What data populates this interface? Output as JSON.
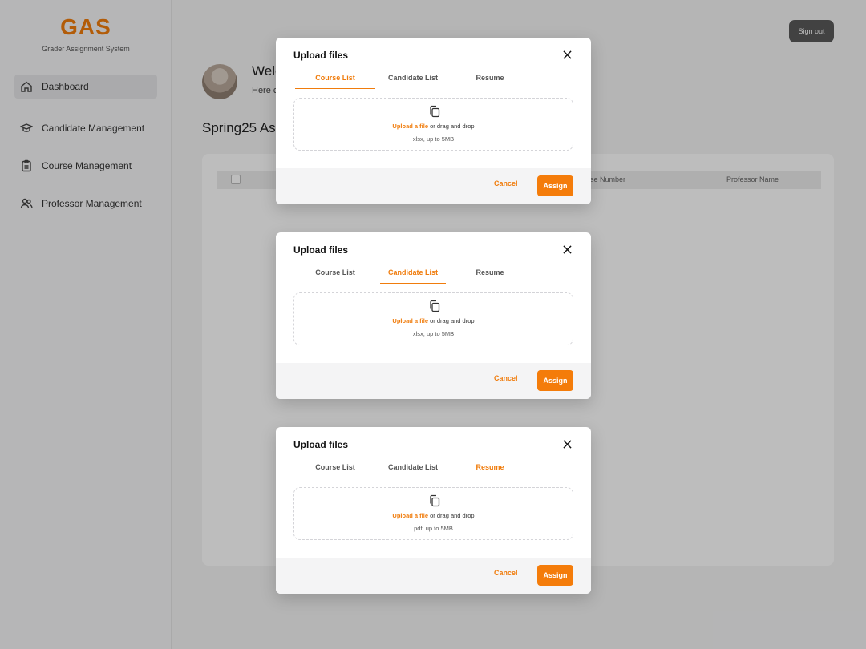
{
  "app": {
    "logo": "GAS",
    "subtitle": "Grader Assignment System",
    "sign_out": "Sign out"
  },
  "sidebar": {
    "items": [
      {
        "label": "Dashboard",
        "icon": "home-icon",
        "active": true
      },
      {
        "label": "Candidate Management",
        "icon": "graduation-cap-icon",
        "active": false
      },
      {
        "label": "Course Management",
        "icon": "clipboard-icon",
        "active": false
      },
      {
        "label": "Professor Management",
        "icon": "users-icon",
        "active": false
      }
    ]
  },
  "main": {
    "welcome_partial": "Welc",
    "welcome_sub_partial": "Here c",
    "title_partial": "Spring25 As",
    "table_headers": [
      "rse Number",
      "Professor Name"
    ]
  },
  "modals": [
    {
      "title": "Upload files",
      "tabs": [
        "Course List",
        "Candidate List",
        "Resume"
      ],
      "active_tab": 0,
      "upload_link": "Upload a file",
      "drop_text": "or drag and drop",
      "hint": "xlsx, up to 5MB",
      "cancel": "Cancel",
      "assign": "Assign"
    },
    {
      "title": "Upload files",
      "tabs": [
        "Course List",
        "Candidate List",
        "Resume"
      ],
      "active_tab": 1,
      "upload_link": "Upload a file",
      "drop_text": "or drag and drop",
      "hint": "xlsx, up to 5MB",
      "cancel": "Cancel",
      "assign": "Assign"
    },
    {
      "title": "Upload files",
      "tabs": [
        "Course List",
        "Candidate List",
        "Resume"
      ],
      "active_tab": 2,
      "upload_link": "Upload a file",
      "drop_text": "or drag and drop",
      "hint": "pdf, up to 5MB",
      "cancel": "Cancel",
      "assign": "Assign"
    }
  ],
  "colors": {
    "accent": "#f07c0c",
    "sign_out_bg": "#5a5a5a"
  }
}
